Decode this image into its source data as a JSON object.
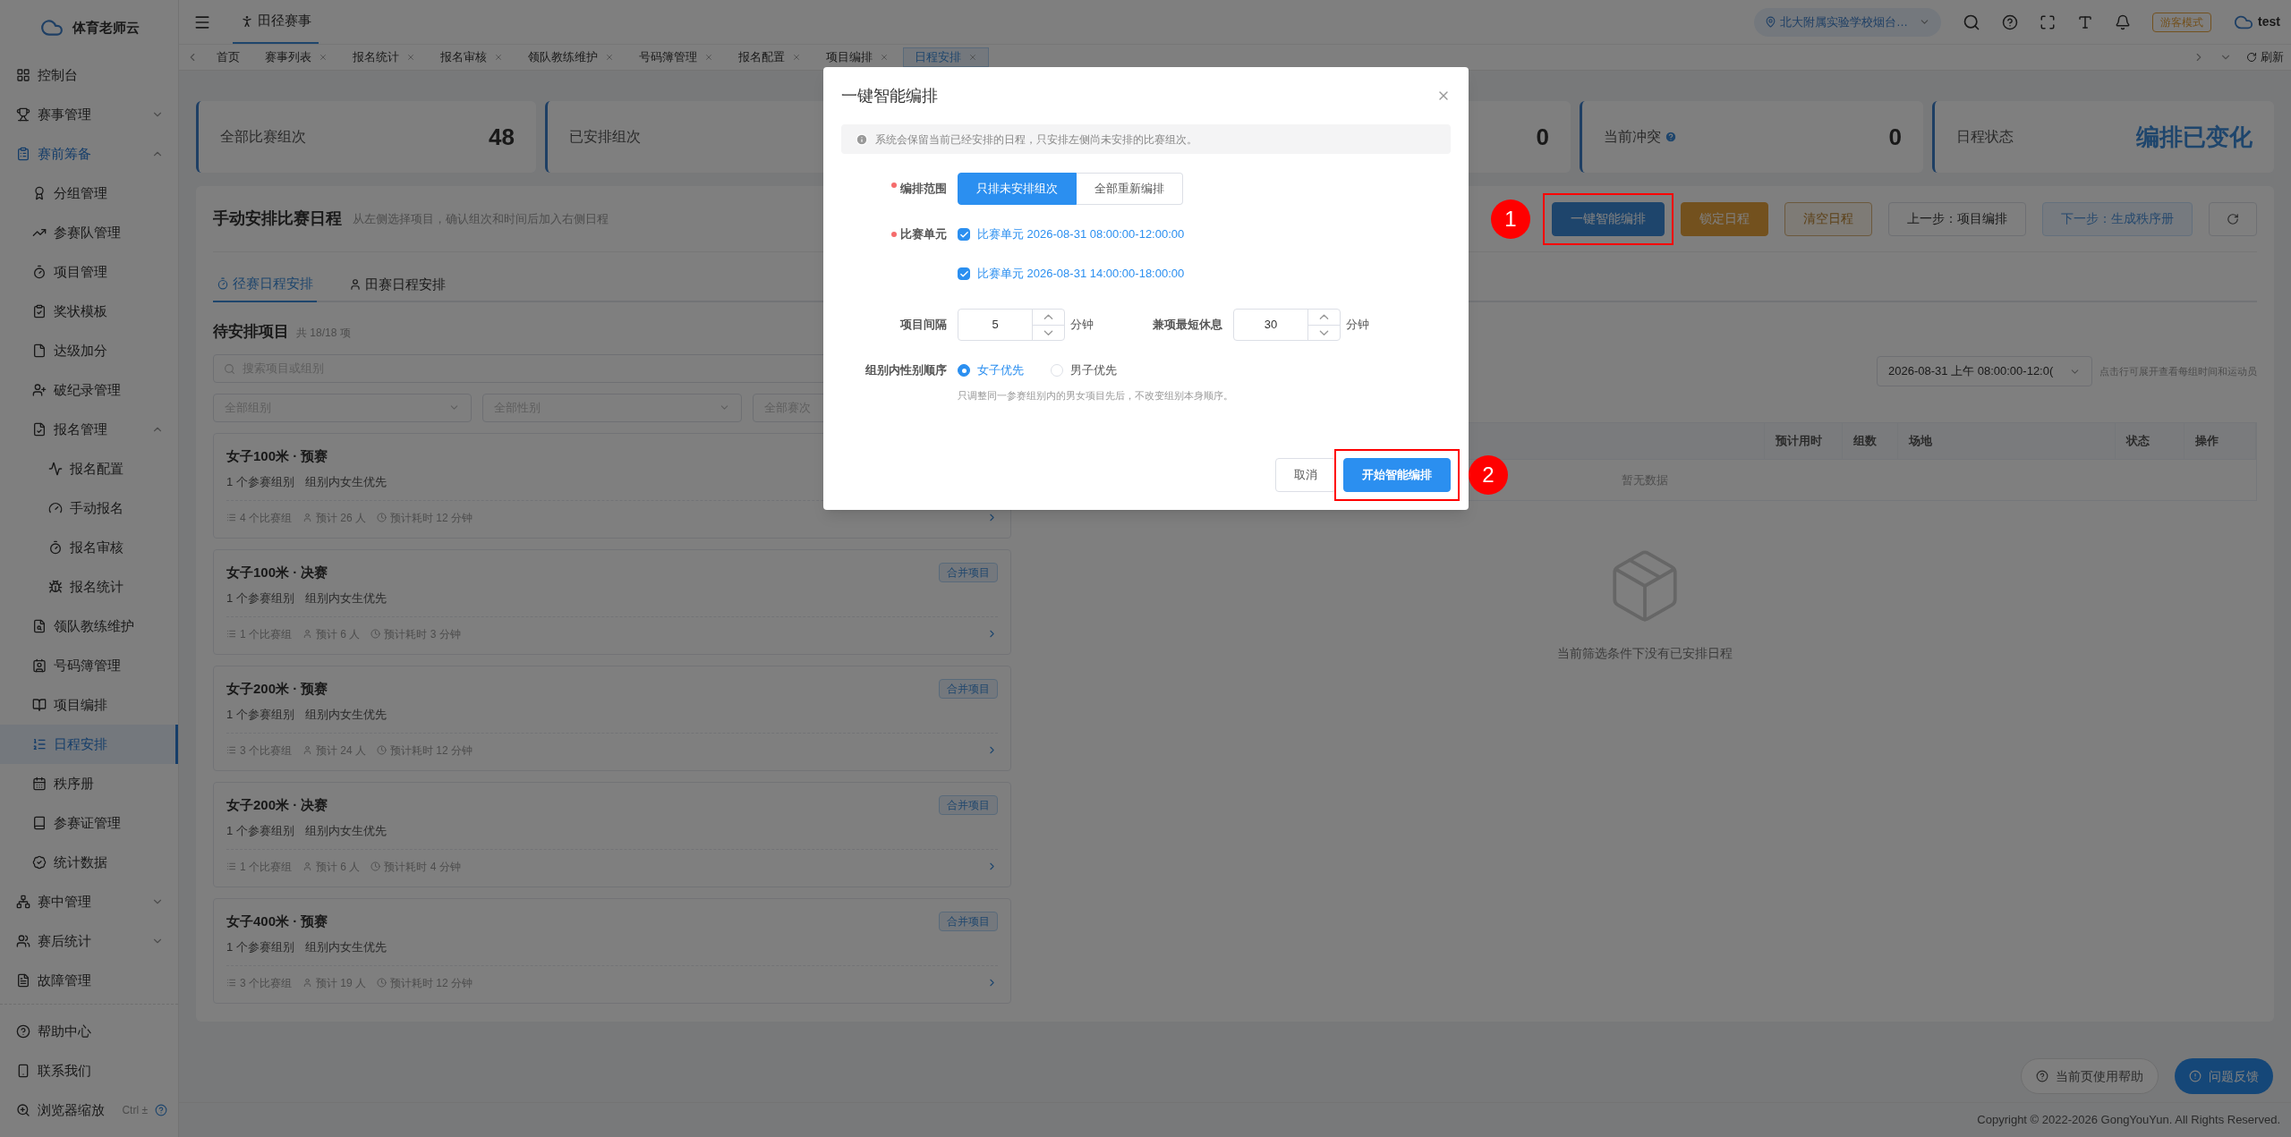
{
  "sidebar": {
    "brand": "体育老师云",
    "items": [
      {
        "label": "控制台",
        "selected": false
      },
      {
        "label": "赛事管理",
        "selected": false,
        "expanded": false
      },
      {
        "label": "赛前筹备",
        "selected": false,
        "expanded": true,
        "children": [
          {
            "label": "分组管理",
            "selected": false
          },
          {
            "label": "参赛队管理",
            "selected": false
          },
          {
            "label": "项目管理",
            "selected": false
          },
          {
            "label": "奖状模板",
            "selected": false
          },
          {
            "label": "达级加分",
            "selected": false
          },
          {
            "label": "破纪录管理",
            "selected": false
          },
          {
            "label": "报名管理",
            "selected": false,
            "expanded": true,
            "children": [
              {
                "label": "报名配置",
                "selected": false
              },
              {
                "label": "手动报名",
                "selected": false
              },
              {
                "label": "报名审核",
                "selected": false
              },
              {
                "label": "报名统计",
                "selected": false
              }
            ]
          },
          {
            "label": "领队教练维护",
            "selected": false
          },
          {
            "label": "号码簿管理",
            "selected": false
          },
          {
            "label": "项目编排",
            "selected": false
          },
          {
            "label": "日程安排",
            "selected": true
          },
          {
            "label": "秩序册",
            "selected": false
          },
          {
            "label": "参赛证管理",
            "selected": false
          },
          {
            "label": "统计数据",
            "selected": false
          }
        ]
      },
      {
        "label": "赛中管理",
        "selected": false,
        "expanded": false
      },
      {
        "label": "赛后统计",
        "selected": false,
        "expanded": false
      },
      {
        "label": "故障管理",
        "selected": false
      }
    ],
    "footer": [
      {
        "label": "帮助中心"
      },
      {
        "label": "联系我们"
      },
      {
        "label": "浏览器缩放",
        "shortcut": "Ctrl ±"
      }
    ]
  },
  "header": {
    "module": "田径赛事",
    "school": "北大附属实验学校烟台…",
    "mode": "游客模式",
    "user": "test"
  },
  "tabs": [
    {
      "label": "首页",
      "selected": false,
      "closable": false
    },
    {
      "label": "赛事列表",
      "selected": false,
      "closable": true
    },
    {
      "label": "报名统计",
      "selected": false,
      "closable": true
    },
    {
      "label": "报名审核",
      "selected": false,
      "closable": true
    },
    {
      "label": "领队教练维护",
      "selected": false,
      "closable": true
    },
    {
      "label": "号码簿管理",
      "selected": false,
      "closable": true
    },
    {
      "label": "报名配置",
      "selected": false,
      "closable": true
    },
    {
      "label": "项目编排",
      "selected": false,
      "closable": true
    },
    {
      "label": "日程安排",
      "selected": true,
      "closable": true
    }
  ],
  "refresh": "刷新",
  "stats": [
    {
      "kind": "number",
      "label": "全部比赛组次",
      "value": "48"
    },
    {
      "label": "已安排组次"
    },
    {
      "kind": "number",
      "value": "0"
    },
    {
      "kind": "number",
      "label": "当前冲突",
      "value": "0",
      "help": true
    },
    {
      "kind": "status",
      "label": "日程状态",
      "value": "编排已变化"
    }
  ],
  "panel": {
    "title": "手动安排比赛日程",
    "subtitle": "从左侧选择项目，确认组次和时间后加入右侧日程",
    "buttons": [
      {
        "label": "一键智能编排",
        "kind": "primary",
        "annotation": "1"
      },
      {
        "label": "锁定日程",
        "kind": "warning"
      },
      {
        "label": "清空日程",
        "kind": "warning-plain"
      },
      {
        "label": "上一步：项目编排",
        "kind": "default"
      },
      {
        "label": "下一步：生成秩序册",
        "kind": "disabled"
      }
    ],
    "subtabs": [
      {
        "label": "径赛日程安排",
        "selected": true
      },
      {
        "label": "田赛日程安排",
        "selected": false
      }
    ],
    "pending": {
      "title": "待安排项目",
      "count": "共 18/18 项",
      "search_placeholder": "搜索项目或组别",
      "filters": [
        "全部组别",
        "全部性别",
        "全部赛次"
      ],
      "items": [
        {
          "title": "女子100米 · 预赛",
          "groups": "1 个参赛组别",
          "order": "组别内女生优先",
          "heats": "4 个比赛组",
          "people": "预计 26 人",
          "duration": "预计耗时 12 分钟"
        },
        {
          "title": "女子100米 · 决赛",
          "groups": "1 个参赛组别",
          "order": "组别内女生优先",
          "heats": "1 个比赛组",
          "people": "预计 6 人",
          "duration": "预计耗时 3 分钟",
          "badge": "合并项目"
        },
        {
          "title": "女子200米 · 预赛",
          "groups": "1 个参赛组别",
          "order": "组别内女生优先",
          "heats": "3 个比赛组",
          "people": "预计 24 人",
          "duration": "预计耗时 12 分钟",
          "badge": "合并项目"
        },
        {
          "title": "女子200米 · 决赛",
          "groups": "1 个参赛组别",
          "order": "组别内女生优先",
          "heats": "1 个比赛组",
          "people": "预计 6 人",
          "duration": "预计耗时 4 分钟",
          "badge": "合并项目"
        },
        {
          "title": "女子400米 · 预赛",
          "groups": "1 个参赛组别",
          "order": "组别内女生优先",
          "heats": "3 个比赛组",
          "people": "预计 19 人",
          "duration": "预计耗时 12 分钟",
          "badge": "合并项目"
        }
      ]
    },
    "schedule": {
      "session": "2026-08-31 上午 08:00:00-12:0(",
      "hint": "点击行可展开查看每组时间和运动员",
      "columns": [
        "预计用时",
        "组数",
        "场地",
        "状态",
        "操作"
      ],
      "empty_row": "暂无数据",
      "empty_text": "当前筛选条件下没有已安排日程"
    }
  },
  "modal": {
    "title": "一键智能编排",
    "notice": "系统会保留当前已经安排的日程，只安排左侧尚未安排的比赛组次。",
    "scope": {
      "label": "编排范围",
      "required": true,
      "options": [
        {
          "label": "只排未安排组次",
          "selected": true
        },
        {
          "label": "全部重新编排",
          "selected": false
        }
      ]
    },
    "units": {
      "label": "比赛单元",
      "required": true,
      "options": [
        {
          "label": "比赛单元 2026-08-31 08:00:00-12:00:00",
          "checked": true
        },
        {
          "label": "比赛单元 2026-08-31 14:00:00-18:00:00",
          "checked": true
        }
      ]
    },
    "interval": {
      "label": "项目间隔",
      "value": "5",
      "unit": "分钟"
    },
    "rest": {
      "label": "兼项最短休息",
      "value": "30",
      "unit": "分钟"
    },
    "gender": {
      "label": "组别内性别顺序",
      "options": [
        {
          "label": "女子优先",
          "selected": true
        },
        {
          "label": "男子优先",
          "selected": false
        }
      ],
      "hint": "只调整同一参赛组别内的男女项目先后，不改变组别本身顺序。"
    },
    "buttons": [
      {
        "label": "取消",
        "kind": "secondary"
      },
      {
        "label": "开始智能编排",
        "kind": "primary",
        "annotation": "2"
      }
    ]
  },
  "floating": [
    {
      "label": "当前页使用帮助",
      "kind": "help"
    },
    {
      "label": "问题反馈",
      "kind": "feedback"
    }
  ],
  "copyright": "Copyright © 2022-2026 GongYouYun. All Rights Reserved."
}
